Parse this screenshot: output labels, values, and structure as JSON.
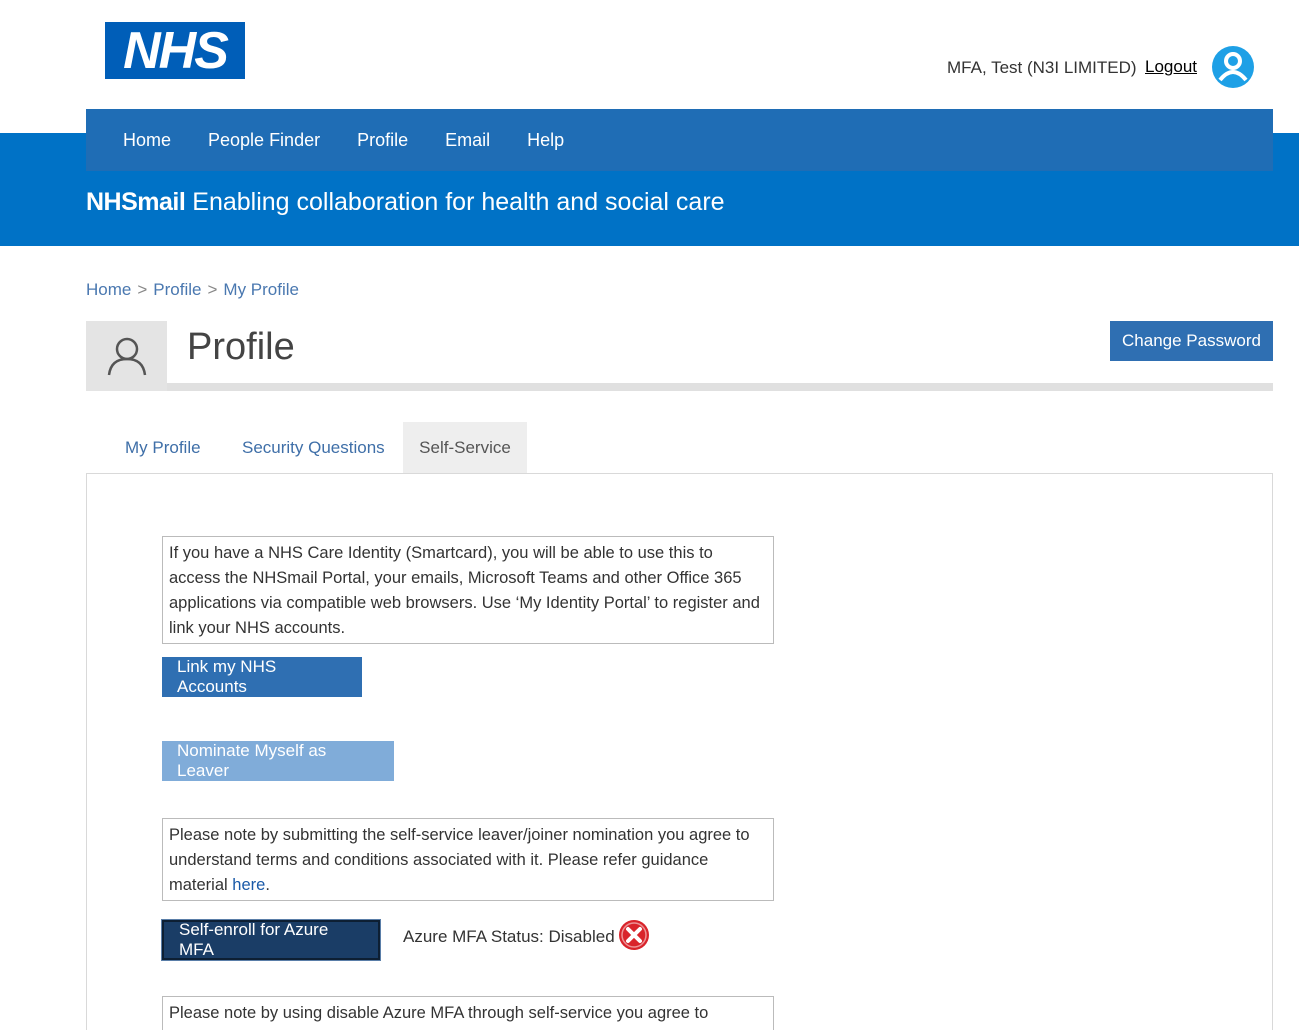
{
  "header": {
    "logo_text": "NHS",
    "user_name": "MFA, Test (N3I LIMITED)",
    "logout_label": "Logout"
  },
  "nav": {
    "items": [
      "Home",
      "People Finder",
      "Profile",
      "Email",
      "Help"
    ]
  },
  "tagline": {
    "brand": "NHSmail",
    "text": "Enabling collaboration for health and social care"
  },
  "breadcrumb": {
    "items": [
      "Home",
      "Profile",
      "My Profile"
    ],
    "separator": ">"
  },
  "page": {
    "title": "Profile",
    "change_password_label": "Change Password"
  },
  "tabs": [
    {
      "label": "My Profile",
      "active": false
    },
    {
      "label": "Security Questions",
      "active": false
    },
    {
      "label": "Self-Service",
      "active": true
    }
  ],
  "self_service": {
    "smartcard_note": "If you have a NHS Care Identity (Smartcard), you will be able to use this to access the NHSmail Portal, your emails, Microsoft Teams and other Office 365 applications via compatible web browsers. Use ‘My Identity Portal’ to register and link your NHS accounts.",
    "link_accounts_label": "Link my NHS Accounts",
    "nominate_leaver_label": "Nominate Myself as Leaver",
    "leaver_note_text": "Please note by submitting the self-service leaver/joiner nomination you agree to understand terms and conditions associated with it. Please refer guidance material ",
    "leaver_note_link": "here",
    "leaver_note_end": ".",
    "mfa_enroll_label": "Self-enroll for Azure MFA",
    "mfa_status_text": "Azure MFA Status: Disabled",
    "mfa_disable_note": "Please note by using disable Azure MFA through self-service you agree to"
  },
  "colors": {
    "nhs_blue": "#005eb8",
    "nav_blue": "#1f6db5",
    "band_blue": "#0072c6",
    "button_blue": "#2f6fb2",
    "status_red": "#d9242b"
  }
}
